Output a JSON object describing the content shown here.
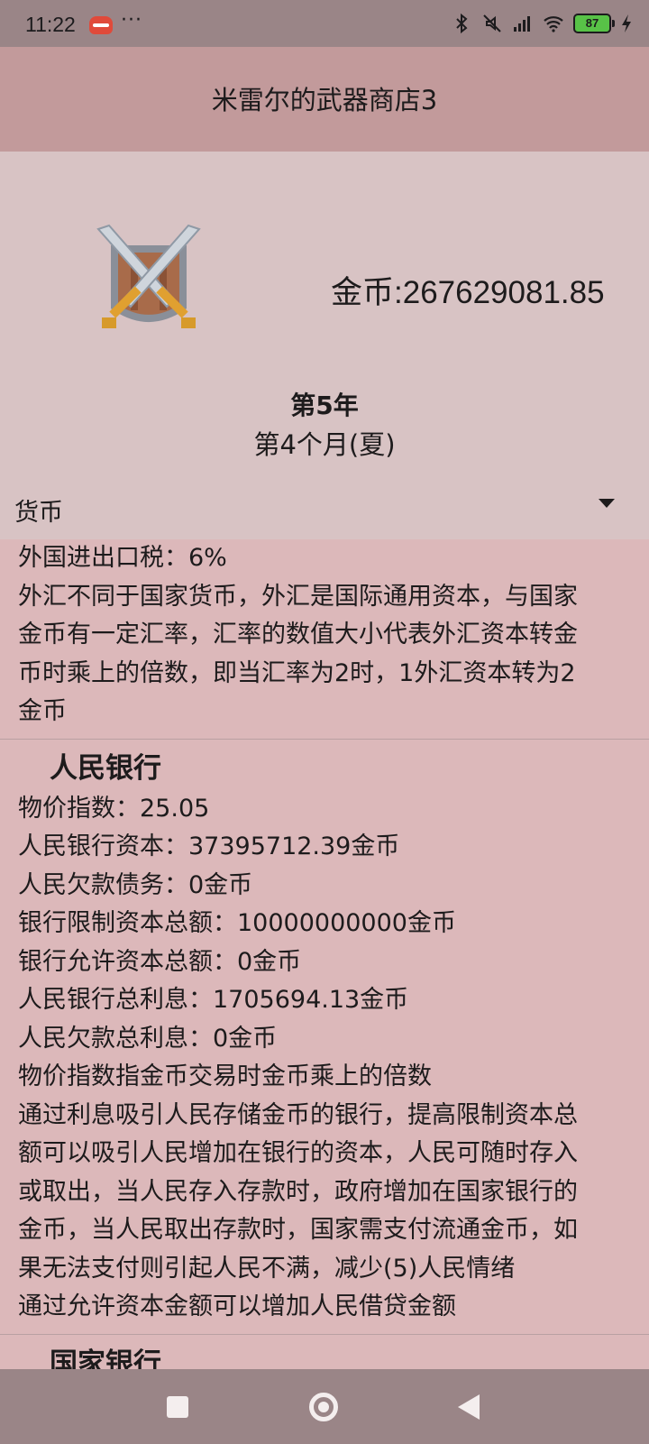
{
  "status_bar": {
    "time": "11:22",
    "more": "···",
    "battery": "87",
    "icons": [
      "bluetooth-icon",
      "mute-icon",
      "signal-icon",
      "wifi-icon",
      "battery-icon",
      "charging-icon"
    ]
  },
  "title": "米雷尔的武器商店3",
  "header": {
    "logo_icon": "crossed-swords-shield-icon",
    "coins": "金币:267629081.85",
    "year": "第5年",
    "month": "第4个月(夏)"
  },
  "dropdown": {
    "selected": "货币"
  },
  "section_currency": {
    "lines": [
      "外国进出口税：6%",
      "外汇不同于国家货币，外汇是国际通用资本，与国家",
      "金币有一定汇率，汇率的数值大小代表外汇资本转金",
      "币时乘上的倍数，即当汇率为2时，1外汇资本转为2",
      "金币"
    ]
  },
  "section_people_bank": {
    "title": "人民银行",
    "lines": [
      "物价指数：25.05",
      "人民银行资本：37395712.39金币",
      "人民欠款债务：0金币",
      "银行限制资本总额：10000000000金币",
      "银行允许资本总额：0金币",
      "人民银行总利息：1705694.13金币",
      "人民欠款总利息：0金币",
      "物价指数指金币交易时金币乘上的倍数",
      "通过利息吸引人民存储金币的银行，提高限制资本总",
      "额可以吸引人民增加在银行的资本，人民可随时存入",
      "或取出，当人民存入存款时，政府增加在国家银行的",
      "金币，当人民取出存款时，国家需支付流通金币，如",
      "果无法支付则引起人民不满，减少(5)人民情绪",
      "通过允许资本金额可以增加人民借贷金额"
    ]
  },
  "section_national_bank": {
    "title": "国家银行"
  },
  "nav": {
    "icons": [
      "recents-square-icon",
      "home-circle-icon",
      "back-triangle-icon"
    ]
  }
}
